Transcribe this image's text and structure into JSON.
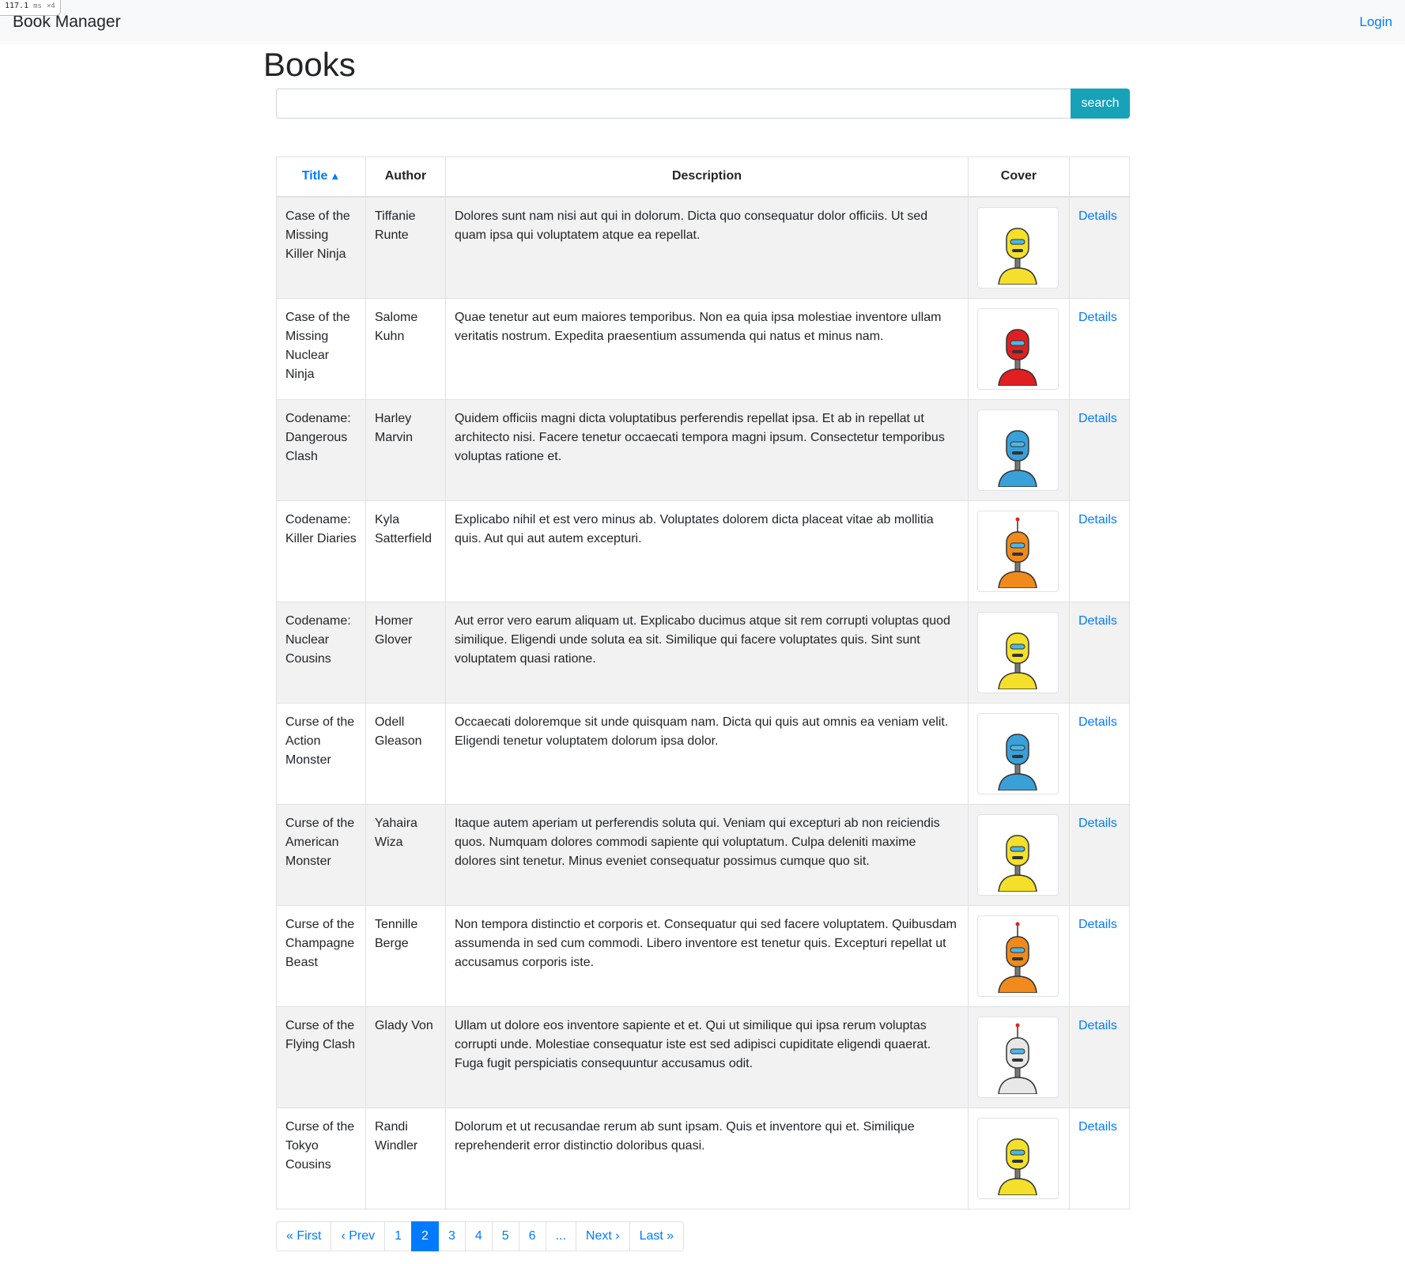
{
  "perf_badge": {
    "value": "117.1",
    "unit": "ms",
    "multiplier": "×4"
  },
  "navbar": {
    "brand": "Book Manager",
    "login": "Login"
  },
  "page_title": "Books",
  "search": {
    "value": "",
    "placeholder": "",
    "button": "search"
  },
  "table": {
    "headers": {
      "title": "Title",
      "title_sort_icon": "▲",
      "author": "Author",
      "description": "Description",
      "cover": "Cover",
      "action": ""
    },
    "rows": [
      {
        "title": "Case of the Missing Killer Ninja",
        "author": "Tiffanie Runte",
        "description": "Dolores sunt nam nisi aut qui in dolorum. Dicta quo consequatur dolor officiis. Ut sed quam ipsa qui voluptatem atque ea repellat.",
        "cover": {
          "icon": "yellow-robot-cover",
          "color": "#f4e02a"
        },
        "action": "Details"
      },
      {
        "title": "Case of the Missing Nuclear Ninja",
        "author": "Salome Kuhn",
        "description": "Quae tenetur aut eum maiores temporibus. Non ea quia ipsa molestiae inventore ullam veritatis nostrum. Expedita praesentium assumenda qui natus et minus nam.",
        "cover": {
          "icon": "red-robot-cover",
          "color": "#e02020"
        },
        "action": "Details"
      },
      {
        "title": "Codename: Dangerous Clash",
        "author": "Harley Marvin",
        "description": "Quidem officiis magni dicta voluptatibus perferendis repellat ipsa. Et ab in repellat ut architecto nisi. Facere tenetur occaecati tempora magni ipsum. Consectetur temporibus voluptas ratione et.",
        "cover": {
          "icon": "blue-robot-cover",
          "color": "#3aa0d8"
        },
        "action": "Details"
      },
      {
        "title": "Codename: Killer Diaries",
        "author": "Kyla Satterfield",
        "description": "Explicabo nihil et est vero minus ab. Voluptates dolorem dicta placeat vitae ab mollitia quis. Aut qui aut autem excepturi.",
        "cover": {
          "icon": "orange-robot-cover",
          "color": "#f08a1c"
        },
        "action": "Details"
      },
      {
        "title": "Codename: Nuclear Cousins",
        "author": "Homer Glover",
        "description": "Aut error vero earum aliquam ut. Explicabo ducimus atque sit rem corrupti voluptas quod similique. Eligendi unde soluta ea sit. Similique qui facere voluptates quis. Sint sunt voluptatem quasi ratione.",
        "cover": {
          "icon": "yellow-robot-cover",
          "color": "#f4e02a"
        },
        "action": "Details"
      },
      {
        "title": "Curse of the Action Monster",
        "author": "Odell Gleason",
        "description": "Occaecati doloremque sit unde quisquam nam. Dicta qui quis aut omnis ea veniam velit. Eligendi tenetur voluptatem dolorum ipsa dolor.",
        "cover": {
          "icon": "blue-robot-cover",
          "color": "#3aa0d8"
        },
        "action": "Details"
      },
      {
        "title": "Curse of the American Monster",
        "author": "Yahaira Wiza",
        "description": "Itaque autem aperiam ut perferendis soluta qui. Veniam qui excepturi ab non reiciendis quos. Numquam dolores commodi sapiente qui voluptatum. Culpa deleniti maxime dolores sint tenetur. Minus eveniet consequatur possimus cumque quo sit.",
        "cover": {
          "icon": "yellow-robot-cover",
          "color": "#f4e02a"
        },
        "action": "Details"
      },
      {
        "title": "Curse of the Champagne Beast",
        "author": "Tennille Berge",
        "description": "Non tempora distinctio et corporis et. Consequatur qui sed facere voluptatem. Quibusdam assumenda in sed cum commodi. Libero inventore est tenetur quis. Excepturi repellat ut accusamus corporis iste.",
        "cover": {
          "icon": "orange-robot-cover",
          "color": "#f08a1c"
        },
        "action": "Details"
      },
      {
        "title": "Curse of the Flying Clash",
        "author": "Glady Von",
        "description": "Ullam ut dolore eos inventore sapiente et et. Qui ut similique qui ipsa rerum voluptas corrupti unde. Molestiae consequatur iste est sed adipisci cupiditate eligendi quaerat. Fuga fugit perspiciatis consequuntur accusamus odit.",
        "cover": {
          "icon": "white-robot-cover",
          "color": "#e8e8e8"
        },
        "action": "Details"
      },
      {
        "title": "Curse of the Tokyo Cousins",
        "author": "Randi Windler",
        "description": "Dolorum et ut recusandae rerum ab sunt ipsam. Quis et inventore qui et. Similique reprehenderit error distinctio doloribus quasi.",
        "cover": {
          "icon": "yellow-robot-cover",
          "color": "#f4e02a"
        },
        "action": "Details"
      }
    ]
  },
  "pagination": {
    "items": [
      {
        "label": "« First",
        "active": false
      },
      {
        "label": "‹ Prev",
        "active": false
      },
      {
        "label": "1",
        "active": false
      },
      {
        "label": "2",
        "active": true
      },
      {
        "label": "3",
        "active": false
      },
      {
        "label": "4",
        "active": false
      },
      {
        "label": "5",
        "active": false
      },
      {
        "label": "6",
        "active": false
      },
      {
        "label": "...",
        "active": false
      },
      {
        "label": "Next ›",
        "active": false
      },
      {
        "label": "Last »",
        "active": false
      }
    ]
  },
  "colors": {
    "link": "#007bff",
    "search_button": "#17a2b8",
    "navbar": "#f8f9fa",
    "stripe": "#f2f2f2"
  }
}
